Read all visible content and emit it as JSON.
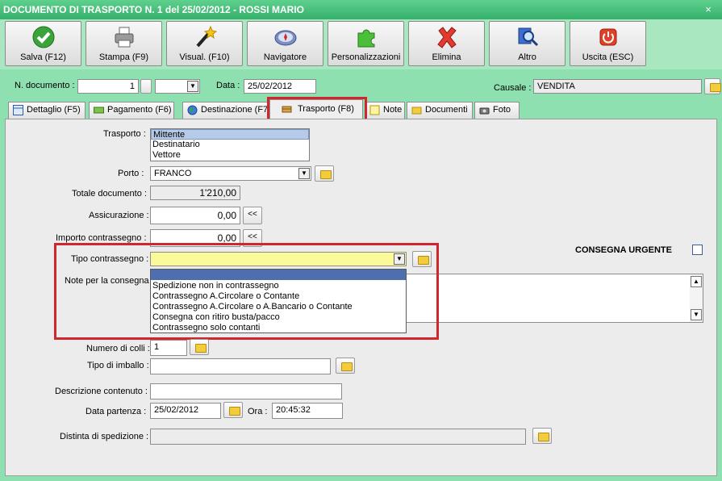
{
  "window": {
    "title": "DOCUMENTO DI TRASPORTO N. 1 del 25/02/2012 - ROSSI MARIO",
    "close_glyph": "×"
  },
  "toolbar": {
    "buttons": [
      {
        "label": "Salva (F12)",
        "icon": "check-icon"
      },
      {
        "label": "Stampa (F9)",
        "icon": "printer-icon"
      },
      {
        "label": "Visual. (F10)",
        "icon": "magic-wand-icon"
      },
      {
        "label": "Navigatore",
        "icon": "compass-icon"
      },
      {
        "label": "Personalizzazioni",
        "icon": "puzzle-icon"
      },
      {
        "label": "Elimina",
        "icon": "delete-x-icon"
      },
      {
        "label": "Altro",
        "icon": "magnifier-icon"
      },
      {
        "label": "Uscita (ESC)",
        "icon": "power-icon"
      }
    ]
  },
  "header": {
    "doc_number_label": "N. documento :",
    "doc_number_value": "1",
    "data_label": "Data :",
    "data_value": "25/02/2012",
    "causale_label": "Causale :",
    "causale_value": "VENDITA"
  },
  "tabs": [
    {
      "label": "Dettaglio (F5)",
      "icon": "grid-icon"
    },
    {
      "label": "Pagamento (F6)",
      "icon": "money-icon"
    },
    {
      "label": "Destinazione (F7)",
      "icon": "globe-icon"
    },
    {
      "label": "Trasporto (F8)",
      "icon": "truck-icon",
      "active": true
    },
    {
      "label": "Note",
      "icon": "note-icon"
    },
    {
      "label": "Documenti",
      "icon": "folder-icon"
    },
    {
      "label": "Foto",
      "icon": "camera-icon"
    }
  ],
  "form": {
    "trasporto_label": "Trasporto :",
    "trasporto_options": [
      "Mittente",
      "Destinatario",
      "Vettore"
    ],
    "trasporto_selected": "Mittente",
    "porto_label": "Porto :",
    "porto_value": "FRANCO",
    "totale_label": "Totale documento :",
    "totale_value": "1'210,00",
    "assicurazione_label": "Assicurazione :",
    "assicurazione_value": "0,00",
    "importo_label": "Importo contrassegno :",
    "importo_value": "0,00",
    "shift_glyph": "<<",
    "consegna_urgente_label": "CONSEGNA URGENTE",
    "tipo_label": "Tipo contrassegno :",
    "tipo_value": "",
    "tipo_options": [
      "Spedizione non in contrassegno",
      "Contrassegno A.Circolare o Contante",
      "Contrassegno A.Circolare o A.Bancario o Contante",
      "Consegna con ritiro busta/pacco",
      "Contrassegno solo contanti"
    ],
    "note_label": "Note per la consegna :",
    "colli_label": "Numero di colli :",
    "colli_value": "1",
    "imballo_label": "Tipo di imballo :",
    "imballo_value": "",
    "descrizione_label": "Descrizione contenuto :",
    "descrizione_value": "",
    "data_partenza_label": "Data partenza :",
    "data_partenza_value": "25/02/2012",
    "ora_label": "Ora :",
    "ora_value": "20:45:32",
    "distinta_label": "Distinta di spedizione :",
    "distinta_value": ""
  },
  "colors": {
    "highlight": "#d0262e",
    "window_bg": "#8fe0b0",
    "dropdown_field": "#fafa9a"
  }
}
